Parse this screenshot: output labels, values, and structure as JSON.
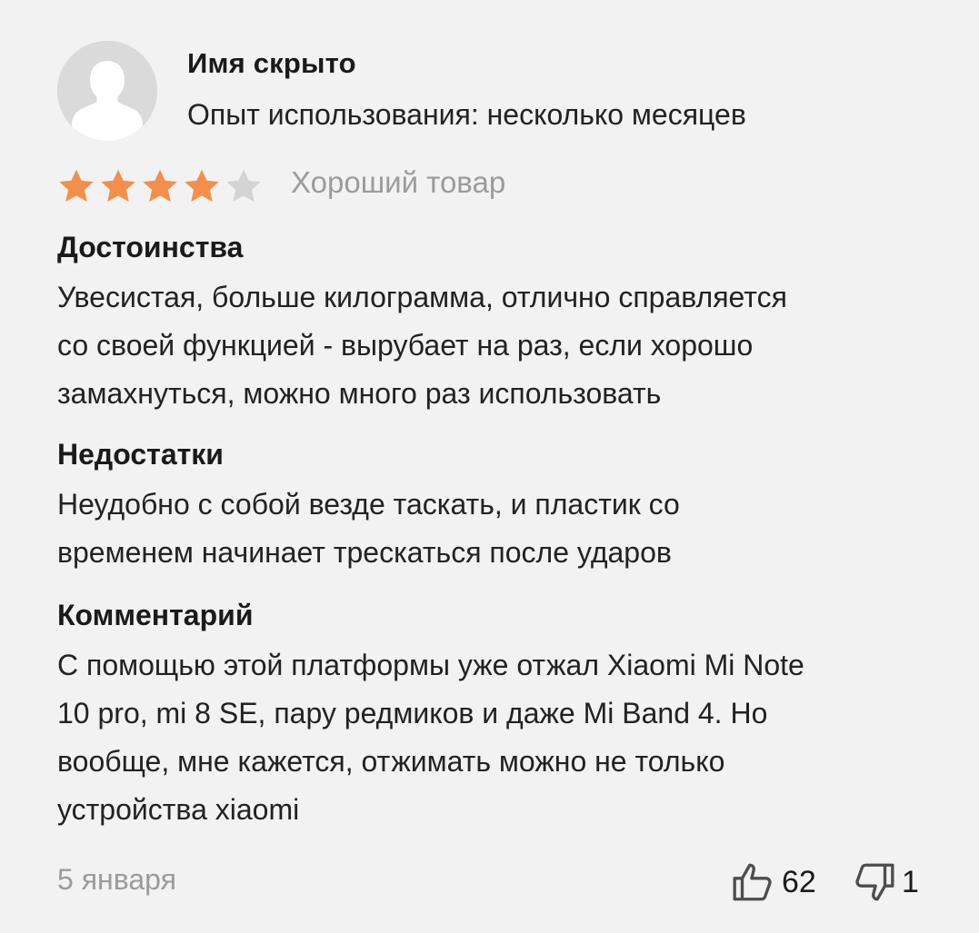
{
  "review": {
    "author": "Имя скрыто",
    "usage": "Опыт использования: несколько месяцев",
    "rating": 4,
    "rating_max": 5,
    "rating_label": "Хороший товар",
    "colors": {
      "star_filled": "#f48f4a",
      "star_empty": "#d4d4d4",
      "muted": "#9b9b9b"
    },
    "pros": {
      "title": "Достоинства",
      "lines": [
        "Увесистая, больше килограмма, отлично справляется",
        "со своей функцией - вырубает на раз, если хорошо",
        "замахнуться, можно много раз использовать"
      ]
    },
    "cons": {
      "title": "Недостатки",
      "lines": [
        "Неудобно с собой везде таскать, и пластик со",
        "временем начинает трескаться после ударов"
      ]
    },
    "comment": {
      "title": "Комментарий",
      "lines": [
        "С помощью этой платформы уже отжал Xiaomi Mi Note",
        "10 pro, mi 8 SE, пару редмиков и даже Mi Band 4. Но",
        "вообще, мне кажется, отжимать можно не только",
        "устройства xiaomi"
      ]
    },
    "date": "5 января",
    "likes": "62",
    "dislikes": "1",
    "icons": {
      "avatar": "user-silhouette-icon",
      "like": "thumb-up-icon",
      "dislike": "thumb-down-icon"
    }
  }
}
